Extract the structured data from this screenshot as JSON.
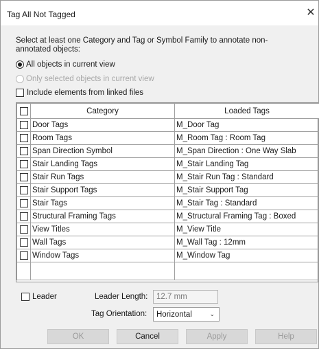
{
  "window": {
    "title": "Tag All Not Tagged",
    "close_icon": "close-icon"
  },
  "instructions": "Select at least one Category and Tag or Symbol Family to annotate non-annotated objects:",
  "scope": {
    "option_all": "All objects in current view",
    "option_selected": "Only selected objects in current view",
    "selected_value": "All objects in current view"
  },
  "include_linked": {
    "label": "Include elements from linked files",
    "checked": false
  },
  "table": {
    "headers": [
      "Category",
      "Loaded Tags"
    ],
    "rows": [
      {
        "category": "Door Tags",
        "tag": "M_Door Tag"
      },
      {
        "category": "Room Tags",
        "tag": "M_Room Tag : Room Tag"
      },
      {
        "category": "Span Direction Symbol",
        "tag": "M_Span Direction : One Way Slab"
      },
      {
        "category": "Stair Landing Tags",
        "tag": "M_Stair Landing Tag"
      },
      {
        "category": "Stair Run Tags",
        "tag": "M_Stair Run Tag : Standard"
      },
      {
        "category": "Stair Support Tags",
        "tag": "M_Stair Support Tag"
      },
      {
        "category": "Stair Tags",
        "tag": "M_Stair Tag : Standard"
      },
      {
        "category": "Structural Framing Tags",
        "tag": "M_Structural Framing Tag : Boxed"
      },
      {
        "category": "View Titles",
        "tag": "M_View Title"
      },
      {
        "category": "Wall Tags",
        "tag": "M_Wall Tag : 12mm"
      },
      {
        "category": "Window Tags",
        "tag": "M_Window Tag"
      }
    ]
  },
  "leader": {
    "label": "Leader",
    "checked": false,
    "length_label": "Leader Length:",
    "length_value": "12.7 mm",
    "orientation_label": "Tag Orientation:",
    "orientation_value": "Horizontal"
  },
  "buttons": {
    "ok": "OK",
    "cancel": "Cancel",
    "apply": "Apply",
    "help": "Help"
  }
}
